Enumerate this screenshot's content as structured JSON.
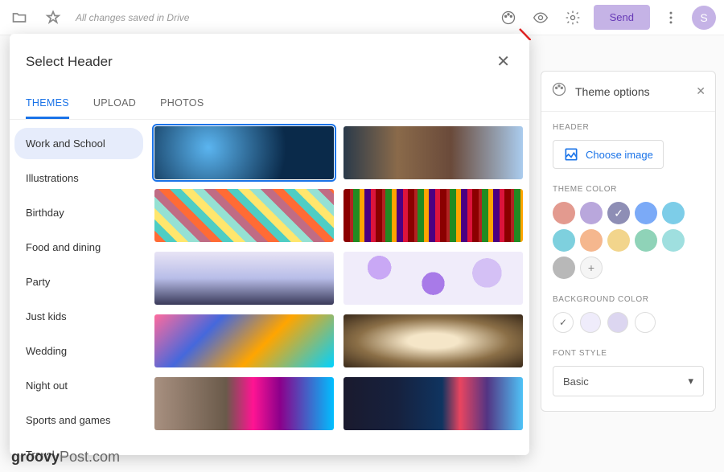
{
  "topbar": {
    "saved_text": "All changes saved in Drive",
    "send_label": "Send",
    "avatar_letter": "S"
  },
  "dialog": {
    "title": "Select Header",
    "tabs": [
      "THEMES",
      "UPLOAD",
      "PHOTOS"
    ],
    "categories": [
      "Work and School",
      "Illustrations",
      "Birthday",
      "Food and dining",
      "Party",
      "Just kids",
      "Wedding",
      "Night out",
      "Sports and games",
      "Travel"
    ]
  },
  "panel": {
    "title": "Theme options",
    "sections": {
      "header": "HEADER",
      "choose_image": "Choose image",
      "theme_color": "THEME COLOR",
      "background_color": "BACKGROUND COLOR",
      "font_style": "FONT STYLE"
    },
    "theme_colors": [
      "#e39a8f",
      "#b9a7dc",
      "#8e8eb5",
      "#7baaf7",
      "#7dcde8",
      "#7ed0de",
      "#f5b78e",
      "#f2d58c",
      "#8fd3b8",
      "#9fdfdf",
      "#b8b8b8"
    ],
    "selected_color_index": 2,
    "bg_colors": [
      "#ffffff",
      "#efecfb",
      "#dcd6f0",
      "#ffffff"
    ],
    "selected_bg_index": 0,
    "font_value": "Basic"
  },
  "watermark": {
    "brand": "groovy",
    "suffix": "Post.com"
  }
}
